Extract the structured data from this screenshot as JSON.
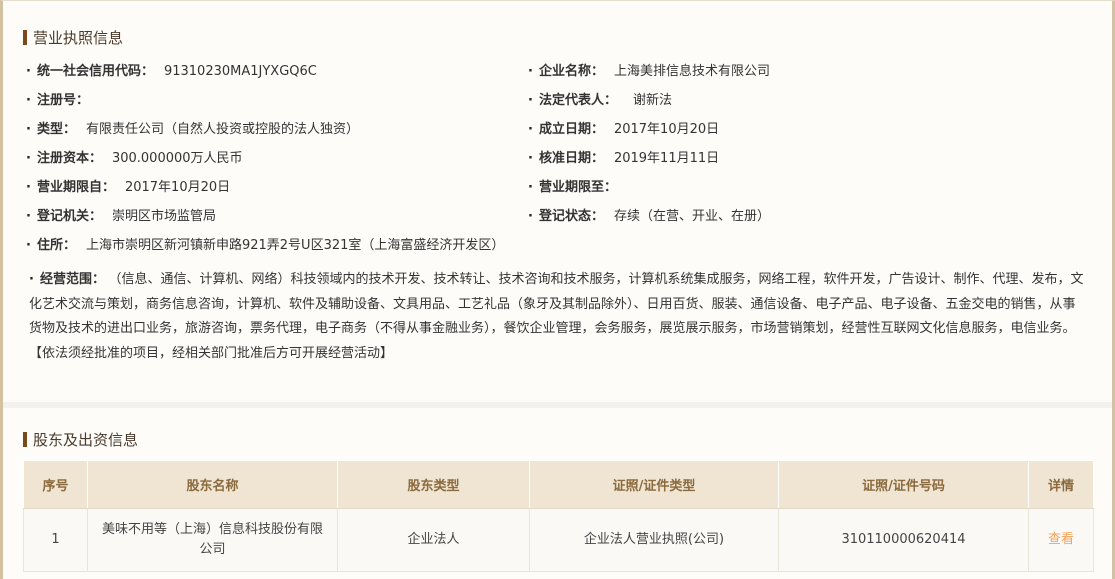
{
  "license_section": {
    "title": "营业执照信息",
    "dot": "·",
    "fields": {
      "credit_code": {
        "label": "统一社会信用代码：",
        "value": "91310230MA1JYXGQ6C"
      },
      "company_name": {
        "label": "企业名称：",
        "value": "上海美排信息技术有限公司"
      },
      "reg_no": {
        "label": "注册号：",
        "value": ""
      },
      "legal_rep": {
        "label": "法定代表人：",
        "value": "谢新法"
      },
      "type": {
        "label": "类型：",
        "value": "有限责任公司（自然人投资或控股的法人独资）"
      },
      "est_date": {
        "label": "成立日期：",
        "value": "2017年10月20日"
      },
      "reg_capital": {
        "label": "注册资本：",
        "value": "300.000000万人民币"
      },
      "approve_date": {
        "label": "核准日期：",
        "value": "2019年11月11日"
      },
      "term_from": {
        "label": "营业期限自：",
        "value": "2017年10月20日"
      },
      "term_to": {
        "label": "营业期限至：",
        "value": ""
      },
      "authority": {
        "label": "登记机关：",
        "value": "崇明区市场监管局"
      },
      "status": {
        "label": "登记状态：",
        "value": "存续（在营、开业、在册）"
      },
      "address": {
        "label": "住所：",
        "value": "上海市崇明区新河镇新申路921弄2号U区321室（上海富盛经济开发区）"
      },
      "scope": {
        "label": "经营范围：",
        "value": "（信息、通信、计算机、网络）科技领域内的技术开发、技术转让、技术咨询和技术服务，计算机系统集成服务，网络工程，软件开发，广告设计、制作、代理、发布，文化艺术交流与策划，商务信息咨询，计算机、软件及辅助设备、文具用品、工艺礼品（象牙及其制品除外）、日用百货、服装、通信设备、电子产品、电子设备、五金交电的销售，从事货物及技术的进出口业务，旅游咨询，票务代理，电子商务（不得从事金融业务），餐饮企业管理，会务服务，展览展示服务，市场营销策划，经营性互联网文化信息服务，电信业务。 【依法须经批准的项目，经相关部门批准后方可开展经营活动】"
      }
    }
  },
  "shareholder_section": {
    "title": "股东及出资信息",
    "columns": [
      "序号",
      "股东名称",
      "股东类型",
      "证照/证件类型",
      "证照/证件号码",
      "详情"
    ],
    "rows": [
      {
        "index": "1",
        "name": "美味不用等（上海）信息科技股份有限公司",
        "type": "企业法人",
        "cert_type": "企业法人营业执照(公司)",
        "cert_no": "310110000620414",
        "detail": "查看"
      }
    ]
  },
  "colors": {
    "accent_bar": "#7a4a1c",
    "header_bg": "#efe5d2",
    "header_text": "#8a6a3e",
    "link": "#f0a35a"
  }
}
